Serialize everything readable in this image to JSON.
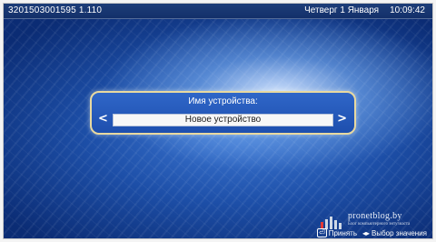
{
  "status_bar": {
    "serial": "3201503001595 1.110",
    "date": "Четверг 1 Января",
    "time": "10:09:42"
  },
  "dialog": {
    "title": "Имя устройства:",
    "value": "Новое устройство",
    "left_arrow": "<",
    "right_arrow": ">"
  },
  "watermark": {
    "name": "pronetblog.by",
    "tagline": "Блог компьютерного энтузиаста"
  },
  "hints": {
    "accept_icon": "⏎",
    "accept_label": "Принять",
    "select_icon": "◂▸",
    "select_label": "Выбор значения"
  },
  "colors": {
    "dialog_border": "#e8d9a0",
    "dialog_bg": "#2f66c8",
    "screen_bg": "#1d4fa8"
  }
}
